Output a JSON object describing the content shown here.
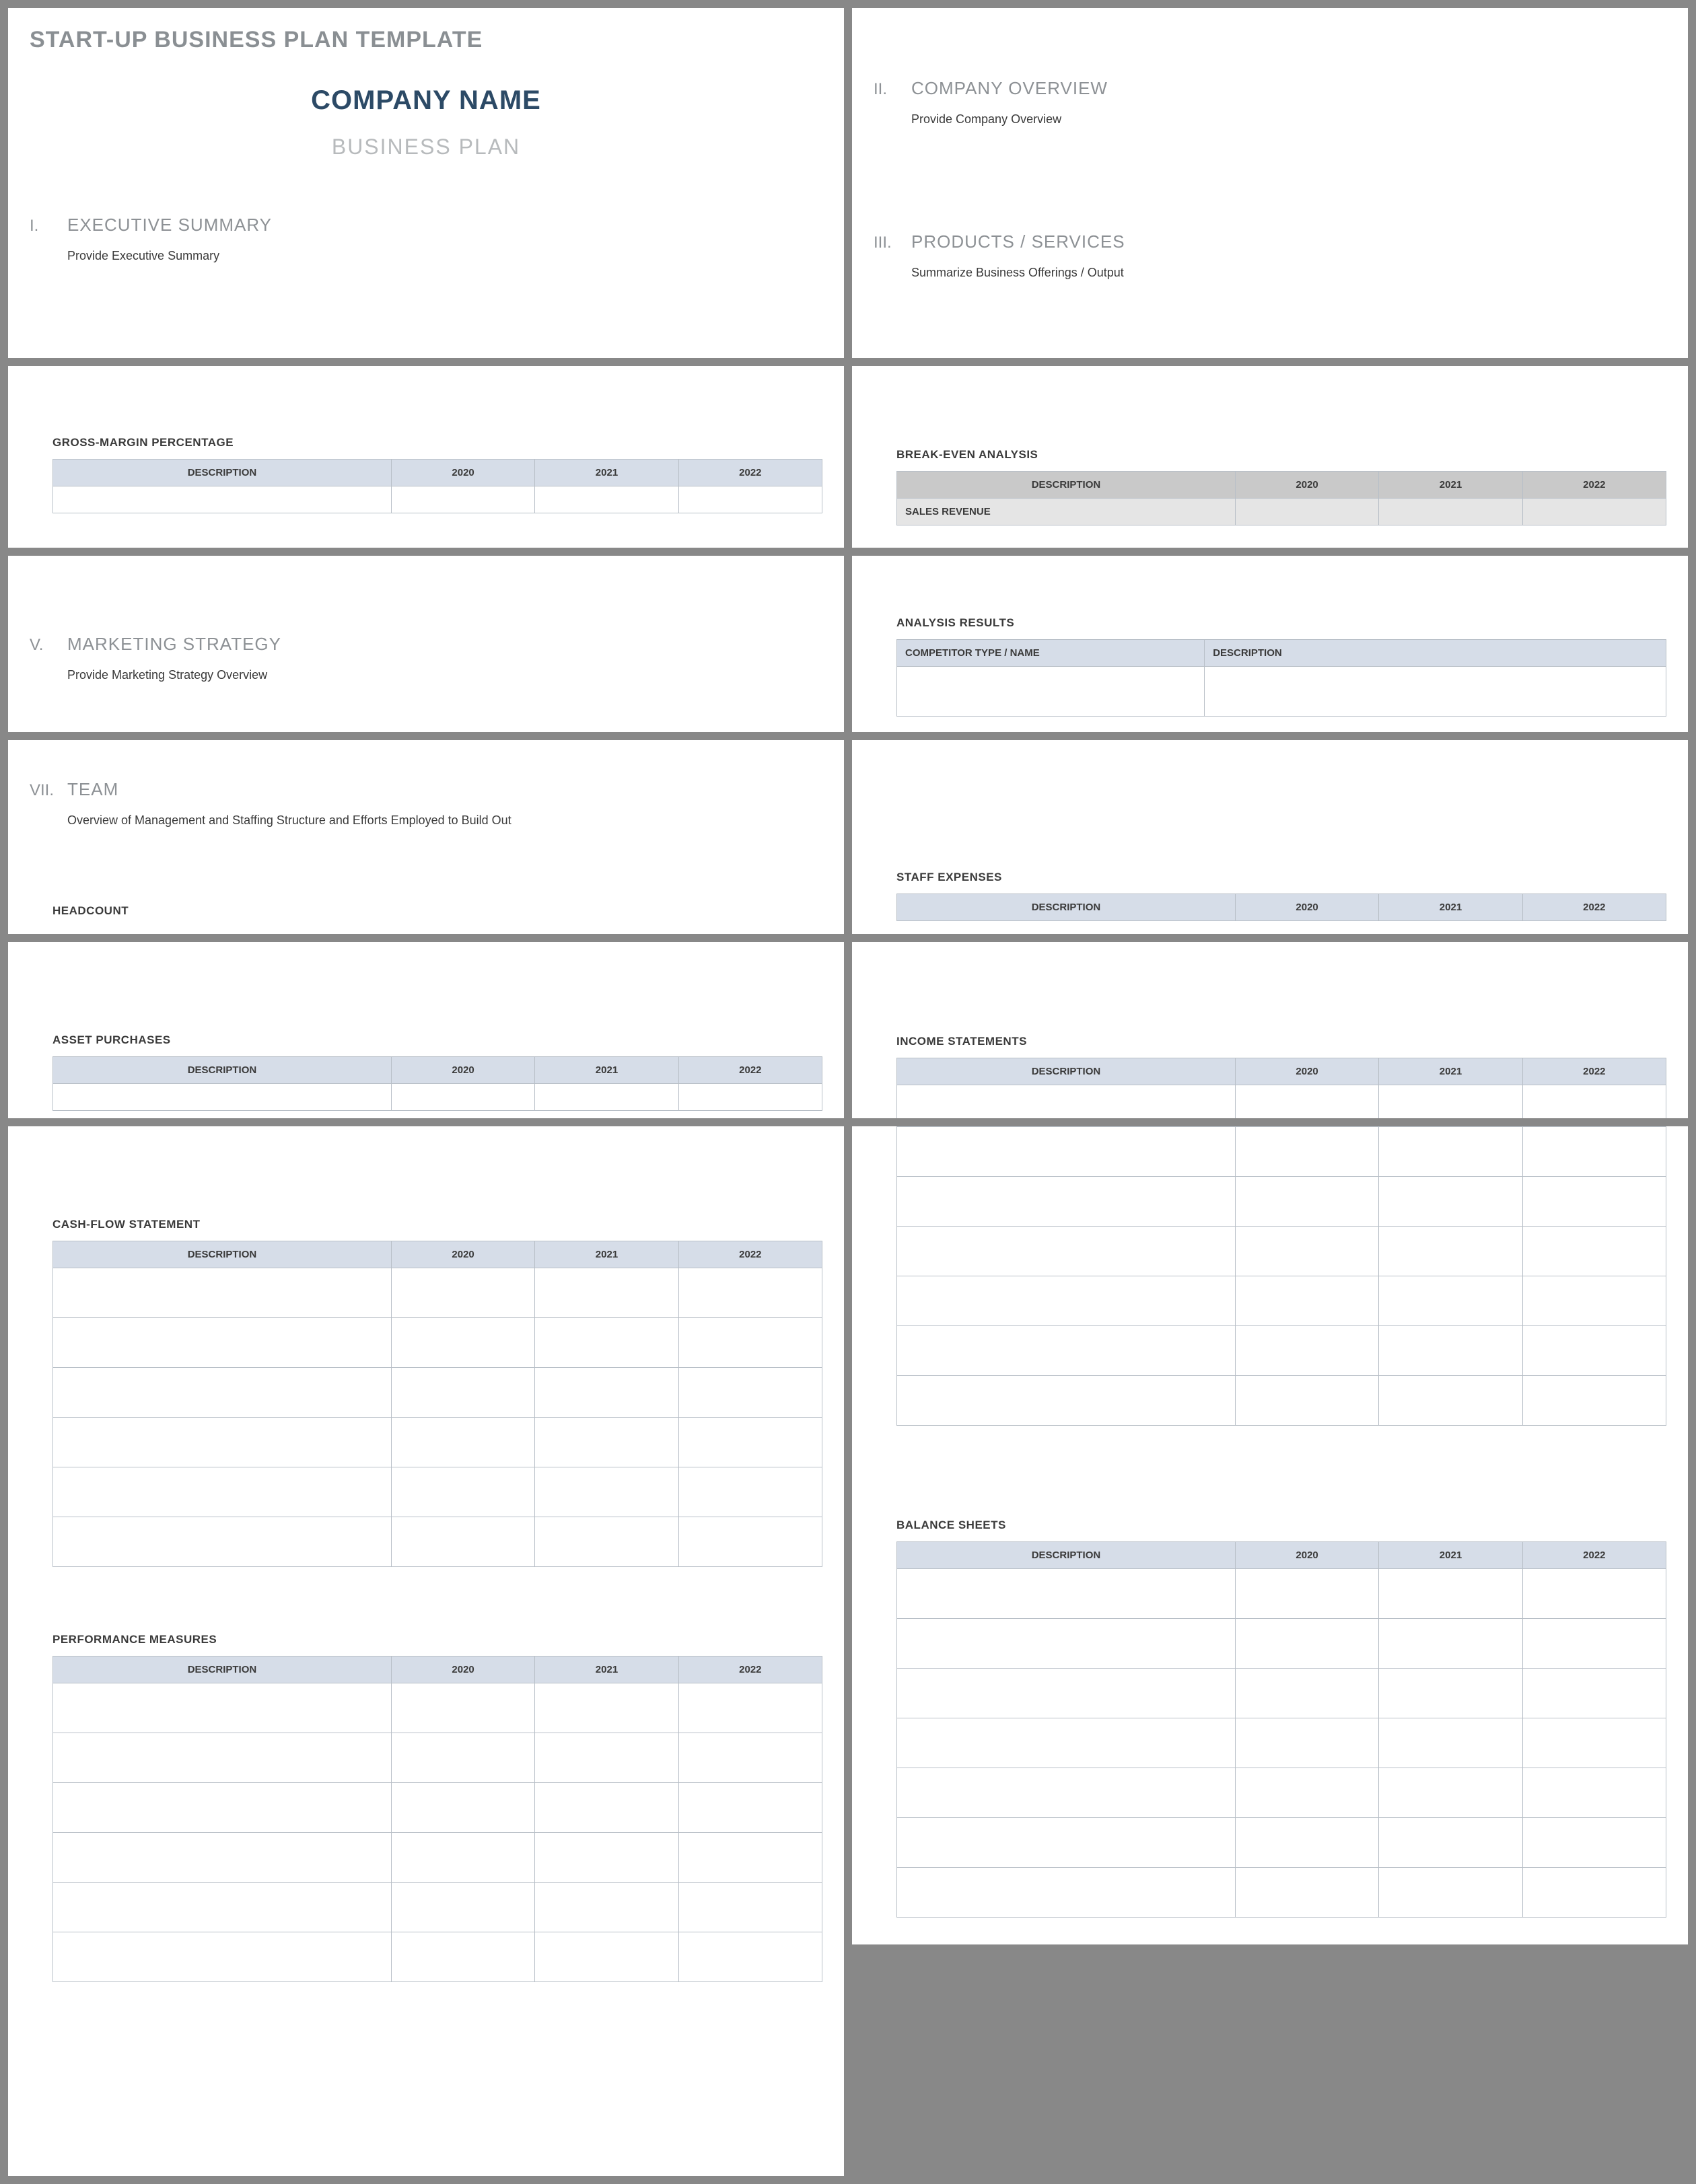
{
  "header": {
    "doc_title": "START-UP BUSINESS PLAN TEMPLATE",
    "company_name": "COMPANY NAME",
    "subtitle": "BUSINESS PLAN"
  },
  "sections": {
    "s1": {
      "num": "I.",
      "title": "EXECUTIVE SUMMARY",
      "body": "Provide Executive Summary"
    },
    "s2": {
      "num": "II.",
      "title": "COMPANY OVERVIEW",
      "body": "Provide Company Overview"
    },
    "s3": {
      "num": "III.",
      "title": "PRODUCTS / SERVICES",
      "body": "Summarize Business Offerings / Output"
    },
    "s5": {
      "num": "V.",
      "title": "MARKETING STRATEGY",
      "body": "Provide Marketing Strategy Overview"
    },
    "s7": {
      "num": "VII.",
      "title": "TEAM",
      "body": "Overview of Management and Staffing Structure and Efforts Employed to Build Out"
    }
  },
  "subs": {
    "gross_margin": "GROSS-MARGIN PERCENTAGE",
    "break_even": "BREAK-EVEN ANALYSIS",
    "analysis_results": "ANALYSIS RESULTS",
    "headcount": "HEADCOUNT",
    "staff_expenses": "STAFF EXPENSES",
    "asset_purchases": "ASSET PURCHASES",
    "income_statements": "INCOME STATEMENTS",
    "cash_flow": "CASH-FLOW STATEMENT",
    "performance": "PERFORMANCE MEASURES",
    "balance_sheets": "BALANCE SHEETS"
  },
  "table_headers": {
    "description": "DESCRIPTION",
    "y2020": "2020",
    "y2021": "2021",
    "y2022": "2022",
    "competitor": "COMPETITOR TYPE / NAME"
  },
  "rows": {
    "sales_revenue": "SALES REVENUE"
  }
}
